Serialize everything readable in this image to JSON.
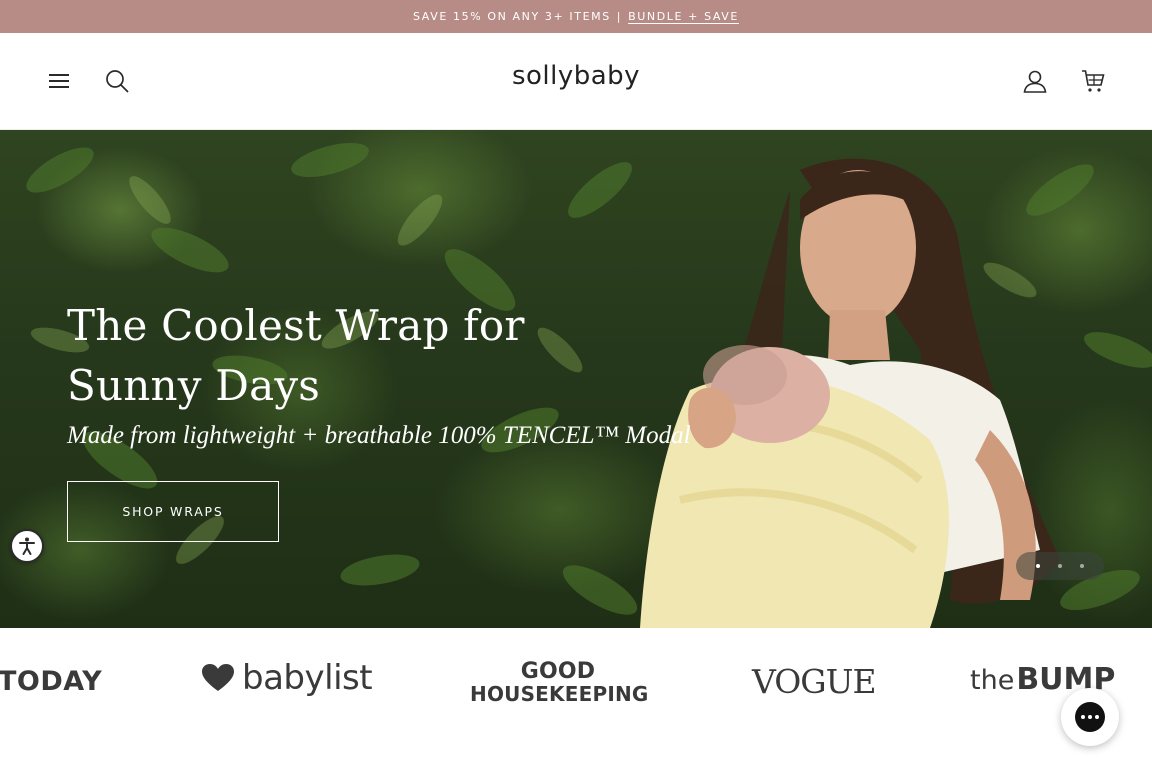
{
  "announcement": {
    "text": "SAVE 15% ON ANY 3+ ITEMS",
    "separator": "|",
    "link": "BUNDLE + SAVE",
    "bg_color": "#b78c87"
  },
  "header": {
    "logo": "sollybaby",
    "icons": [
      "menu-icon",
      "search-icon",
      "account-icon",
      "cart-icon"
    ]
  },
  "hero": {
    "title": "The Coolest Wrap for Sunny Days",
    "subtitle": "Made from lightweight + breathable 100% TENCEL™ Modal",
    "button": "SHOP WRAPS",
    "slides_total": 3,
    "active_slide": 1
  },
  "press": {
    "today": "TODAY",
    "babylist": "babylist",
    "good_housekeeping_line1": "GOOD",
    "good_housekeeping_line2": "HOUSEKEEPING",
    "vogue": "VOGUE",
    "bump_the": "the",
    "bump_word": "BUMP"
  },
  "widgets": {
    "accessibility": "accessibility-icon",
    "chat": "chat-icon"
  }
}
